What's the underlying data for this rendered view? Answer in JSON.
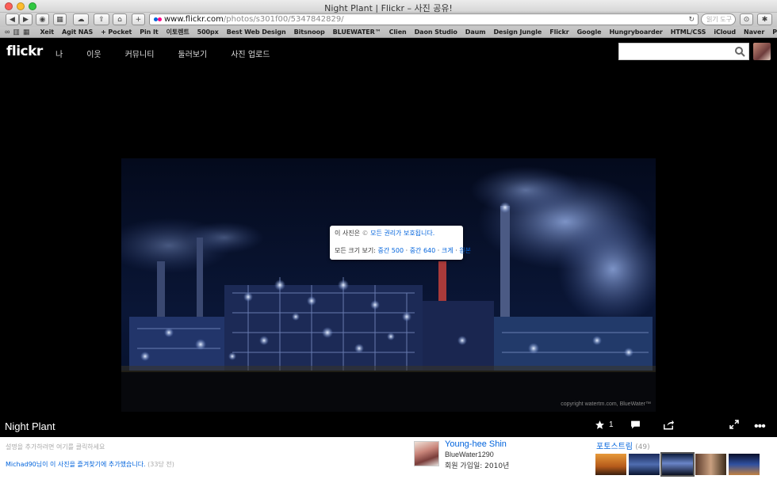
{
  "browser": {
    "window_title": "Night Plant | Flickr – 사진 공유!",
    "address_host": "www.flickr.com",
    "address_path": "/photos/s301f00/5347842829/",
    "search_placeholder": "읽기 도구",
    "bookmarks": [
      "Xeit",
      "Agit NAS",
      "+ Pocket",
      "Pin It",
      "이토렌트",
      "500px",
      "Best Web Design",
      "Bitsnoop",
      "BLUEWATER™",
      "Clien",
      "Daon Studio",
      "Daum",
      "Design Jungle",
      "Flickr",
      "Google",
      "Hungryboarder",
      "HTML/CSS",
      "iCloud",
      "Naver",
      "Parkoz"
    ]
  },
  "flickr_header": {
    "logo": "flickr",
    "nav": [
      "나",
      "이웃",
      "커뮤니티",
      "둘러보기",
      "사진 업로드"
    ]
  },
  "photo": {
    "title": "Night Plant",
    "watermark": "copyright watertm.com, BlueWater™",
    "fave_count": "1",
    "popup": {
      "rights_prefix": "이 사진은",
      "rights_link": "모든 권리가 보호됩니다.",
      "sizes_label": "모든 크기 보기:",
      "sizes": [
        "중간 500",
        "중간 640",
        "크게",
        "원본"
      ]
    }
  },
  "description": {
    "placeholder": "설명을 추가하려면 여기를 클릭하세요"
  },
  "activity": {
    "user": "Michad90",
    "text": "님이 이 사진을 즐겨찾기에 추가했습니다.",
    "time": "(33당 전)"
  },
  "owner": {
    "name": "Young-hee Shin",
    "username": "BlueWater1290",
    "joined": "회원 가입일: 2010년"
  },
  "photostream": {
    "title": "포토스트림",
    "count": "(49)"
  }
}
